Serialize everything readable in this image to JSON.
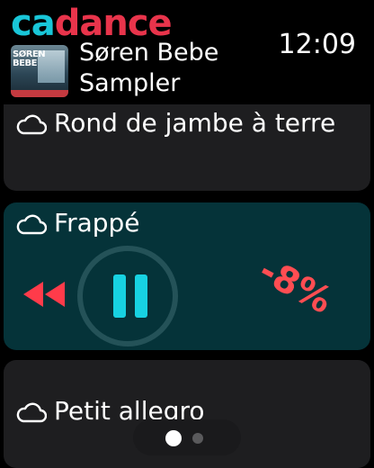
{
  "app": {
    "logo_ca": "ca",
    "logo_d": "d",
    "logo_ance": "ance"
  },
  "status": {
    "time": "12:09"
  },
  "playlist": {
    "title_line1": "Søren Bebe",
    "title_line2": "Sampler",
    "album_art_text": "SØREN BEBE"
  },
  "tracks": [
    {
      "label": "Rond de jambe à terre",
      "icon": "cloud-icon"
    },
    {
      "label": "Frappé",
      "icon": "cloud-icon",
      "active": true
    },
    {
      "label": "Petit allegro",
      "icon": "cloud-icon"
    }
  ],
  "player": {
    "tempo": "-8%",
    "state": "playing"
  },
  "pager": {
    "current": 1,
    "total": 2
  },
  "colors": {
    "accent_cyan": "#17d2e2",
    "accent_red": "#e8344b",
    "active_card": "#053339",
    "card": "#1e1e20"
  }
}
